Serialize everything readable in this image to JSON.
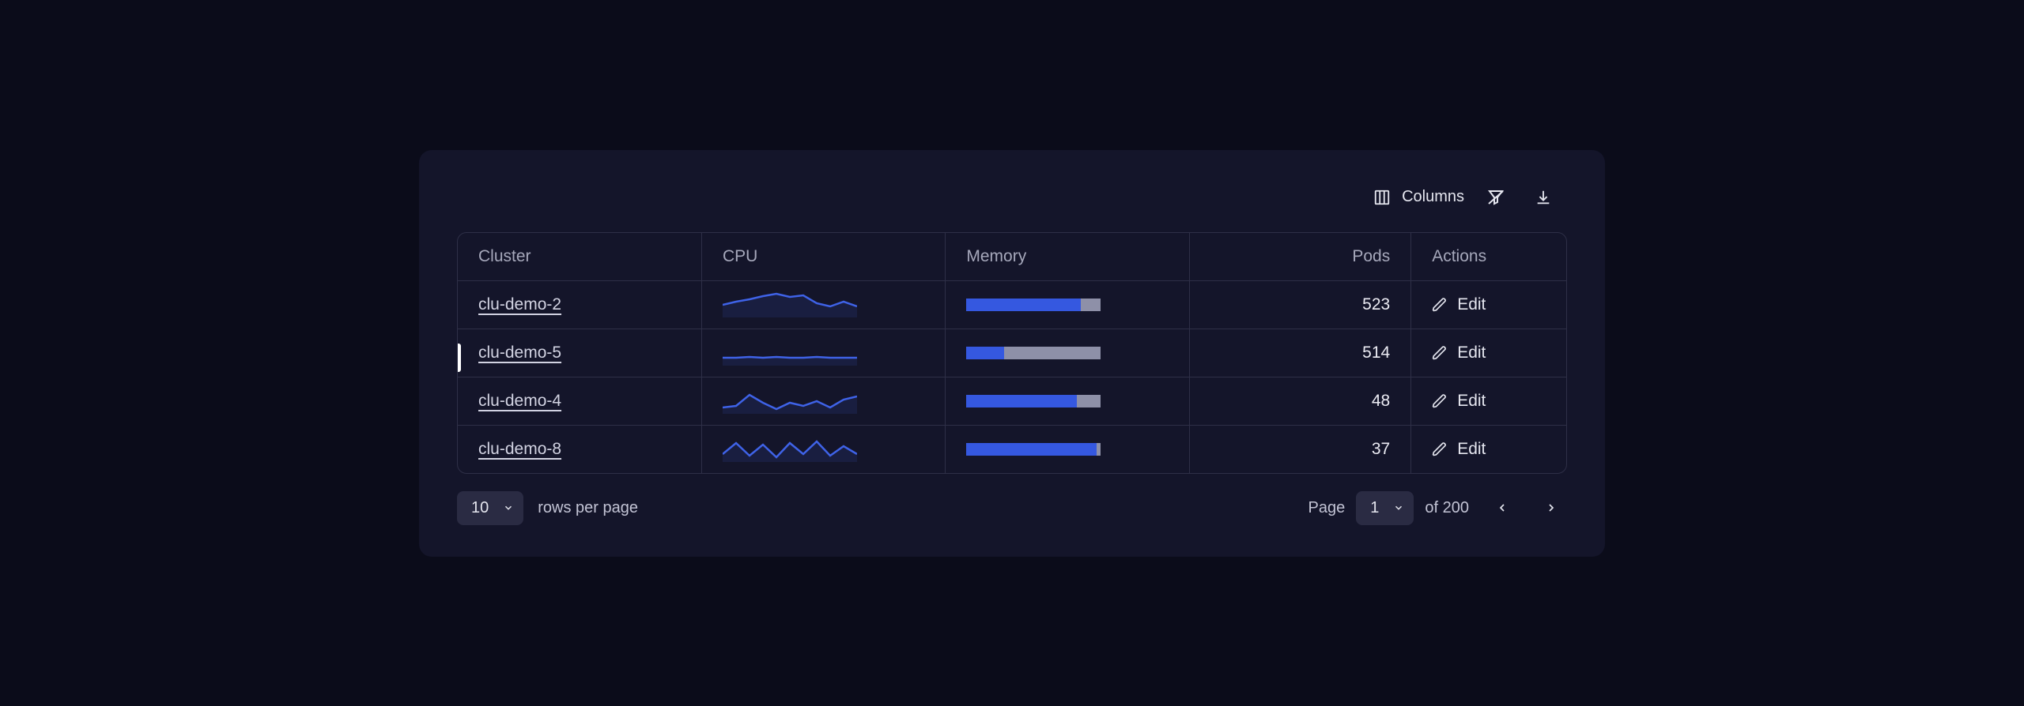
{
  "toolbar": {
    "columns_label": "Columns"
  },
  "columns": {
    "cluster": "Cluster",
    "cpu": "CPU",
    "memory": "Memory",
    "pods": "Pods",
    "actions": "Actions"
  },
  "rows": [
    {
      "cluster": "clu-demo-2",
      "memory_pct": 85,
      "pods": "523",
      "edit": "Edit",
      "spark": [
        16,
        12,
        9,
        5,
        2,
        6,
        4,
        14,
        18,
        12,
        18
      ],
      "active": false
    },
    {
      "cluster": "clu-demo-5",
      "memory_pct": 28,
      "pods": "514",
      "edit": "Edit",
      "spark": [
        22,
        22,
        21,
        22,
        21,
        22,
        22,
        21,
        22,
        22,
        22
      ],
      "active": true
    },
    {
      "cluster": "clu-demo-4",
      "memory_pct": 82,
      "pods": "48",
      "edit": "Edit",
      "spark": [
        24,
        22,
        8,
        18,
        26,
        18,
        22,
        16,
        24,
        14,
        10
      ],
      "active": false
    },
    {
      "cluster": "clu-demo-8",
      "memory_pct": 97,
      "pods": "37",
      "edit": "Edit",
      "spark": [
        22,
        8,
        24,
        10,
        26,
        8,
        22,
        6,
        24,
        12,
        22
      ],
      "active": false
    }
  ],
  "pagination": {
    "rows_per_page_value": "10",
    "rows_per_page_label": "rows per page",
    "page_label": "Page",
    "page_value": "1",
    "of_label": "of 200"
  }
}
